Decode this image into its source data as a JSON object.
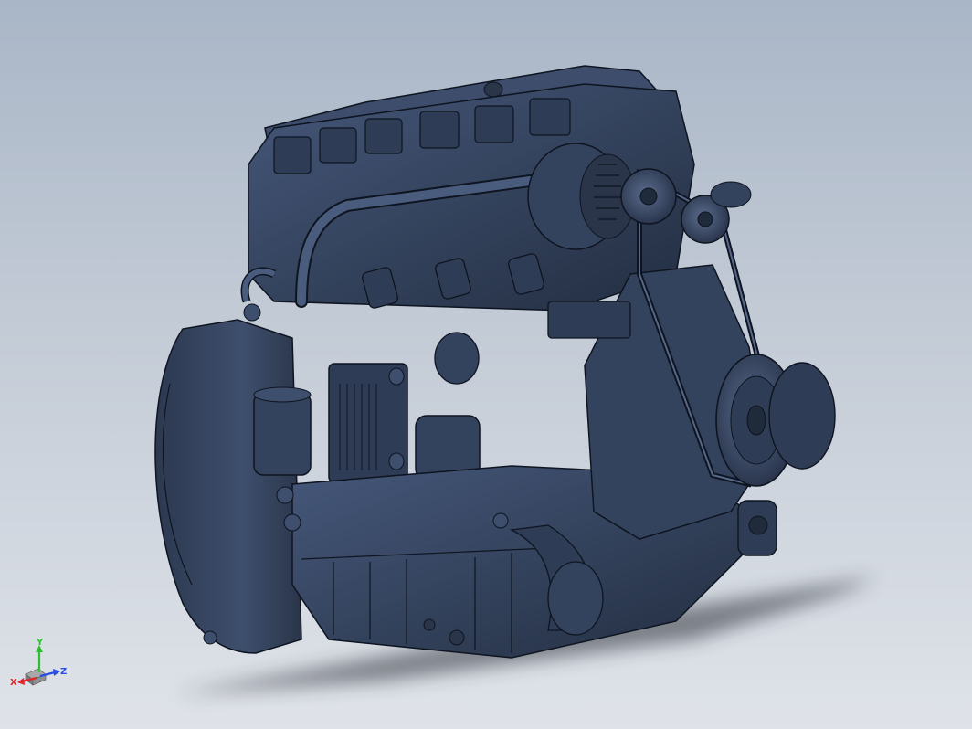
{
  "viewport": {
    "background_top": "#a9b6c7",
    "background_bottom": "#dfe3e9",
    "model_color": "#3a4a63",
    "model_dark": "#1f2a3b",
    "edge_color": "#0e1420",
    "shadow_color": "#2a2f38"
  },
  "triad": {
    "x_label": "X",
    "y_label": "Y",
    "z_label": "Z",
    "x_color": "#e0262a",
    "y_color": "#2fbf2f",
    "z_color": "#2a4fe0"
  }
}
